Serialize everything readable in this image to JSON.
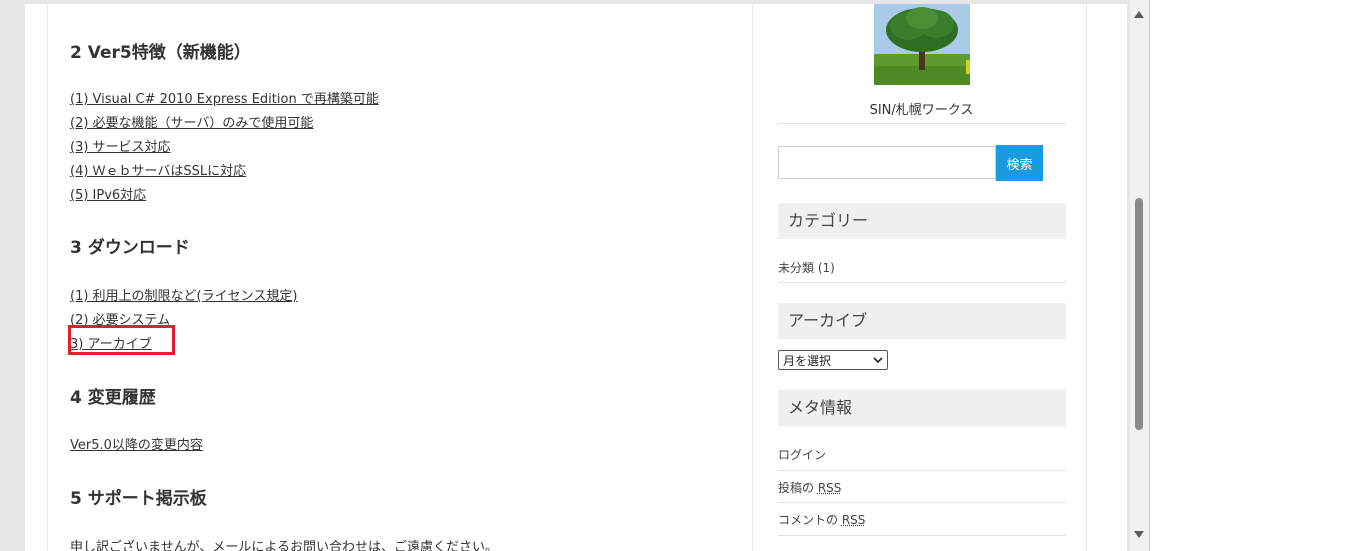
{
  "main": {
    "section2": {
      "heading": "2 Ver5特徴（新機能）",
      "links": [
        "(1) Visual C# 2010 Express Edition で再構築可能",
        "(2) 必要な機能（サーバ）のみで使用可能",
        "(3) サービス対応",
        "(4) ＷｅｂサーバはSSLに対応",
        "(5) IPv6対応"
      ]
    },
    "section3": {
      "heading": "3 ダウンロード",
      "links": [
        "(1) 利用上の制限など(ライセンス規定)",
        "(2) 必要システム",
        "3) アーカイブ"
      ]
    },
    "section4": {
      "heading": "4 変更履歴",
      "link": "Ver5.0以降の変更内容"
    },
    "section5": {
      "heading": "5 サポート掲示板",
      "text": "申し訳ございませんが、メールによるお問い合わせは、ご遠慮ください。"
    }
  },
  "sidebar": {
    "site_name": "SIN/札幌ワークス",
    "search": {
      "value": "",
      "button_label": "検索"
    },
    "categories": {
      "title": "カテゴリー",
      "item": "未分類",
      "count": "(1)"
    },
    "archives": {
      "title": "アーカイブ",
      "select_value": "月を選択"
    },
    "meta": {
      "title": "メタ情報",
      "login": "ログイン",
      "posts_rss_prefix": "投稿の ",
      "comments_rss_prefix": "コメントの ",
      "rss": "RSS"
    }
  },
  "colors": {
    "accent": "#1a9ae0",
    "highlight": "#e0202e"
  }
}
